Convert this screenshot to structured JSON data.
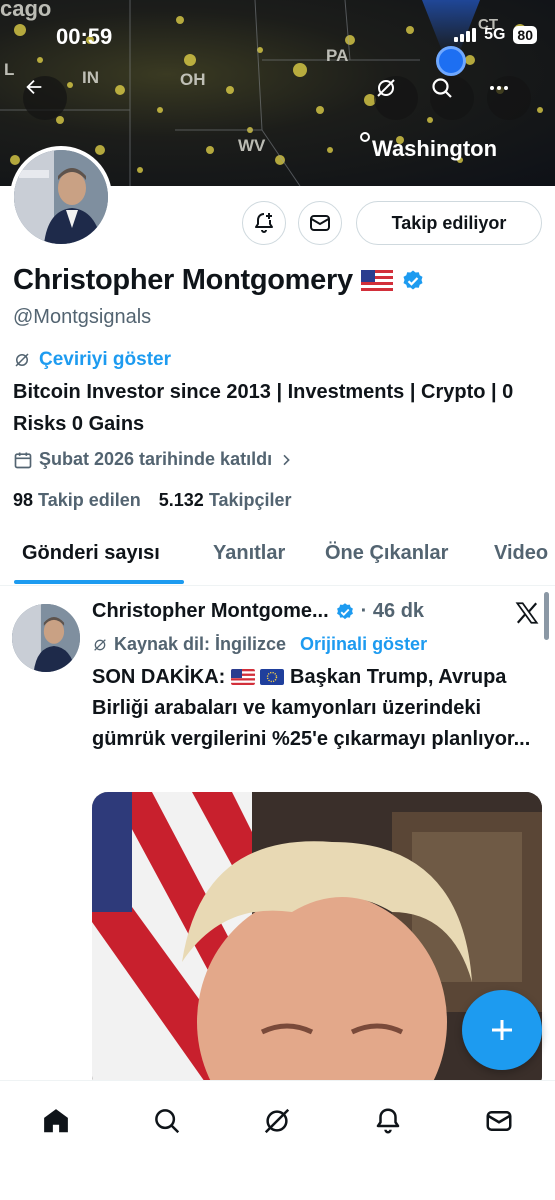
{
  "status_bar": {
    "time": "00:59",
    "network": "5G",
    "battery": "80"
  },
  "map_labels": {
    "city_top_left": "cago",
    "state_il": "L",
    "state_in": "IN",
    "state_oh": "OH",
    "state_pa": "PA",
    "state_wv": "WV",
    "state_ct": "CT",
    "city_washington": "Washington"
  },
  "profile": {
    "name": "Christopher Montgomery",
    "handle": "@Montgsignals",
    "translate_label": "Çeviriyi göster",
    "bio": "Bitcoin Investor since 2013 | Investments | Crypto | 0 Risks 0 Gains",
    "joined": "Şubat 2026 tarihinde katıldı",
    "following_count": "98",
    "following_label": "Takip edilen",
    "followers_count": "5.132",
    "followers_label": "Takipçiler",
    "follow_button": "Takip ediliyor"
  },
  "tabs": [
    {
      "label": "Gönderi sayısı",
      "active": true
    },
    {
      "label": "Yanıtlar",
      "active": false
    },
    {
      "label": "Öne Çıkanlar",
      "active": false
    },
    {
      "label": "Video",
      "active": false
    }
  ],
  "tweet": {
    "author": "Christopher Montgome...",
    "time": "· 46 dk",
    "source_language": "Kaynak dil: İngilizce",
    "show_original": "Orijinali göster",
    "text_prefix": "SON DAKİKA:",
    "text_after_flags": "Başkan Trump,",
    "text_body": "Avrupa Birliği arabaları ve kamyonları üzerindeki gümrük vergilerini %25'e çıkarmayı planlıyor..."
  },
  "colors": {
    "accent": "#1d9bf0",
    "text": "#0f1419",
    "muted": "#536471"
  },
  "icons": [
    "back-icon",
    "translate-icon",
    "search-icon",
    "more-icon",
    "notify-plus-icon",
    "mail-icon",
    "verified-icon",
    "calendar-icon",
    "chevron-right-icon",
    "x-logo-icon",
    "compose-plus-icon",
    "home-icon",
    "grok-icon",
    "bell-icon"
  ]
}
